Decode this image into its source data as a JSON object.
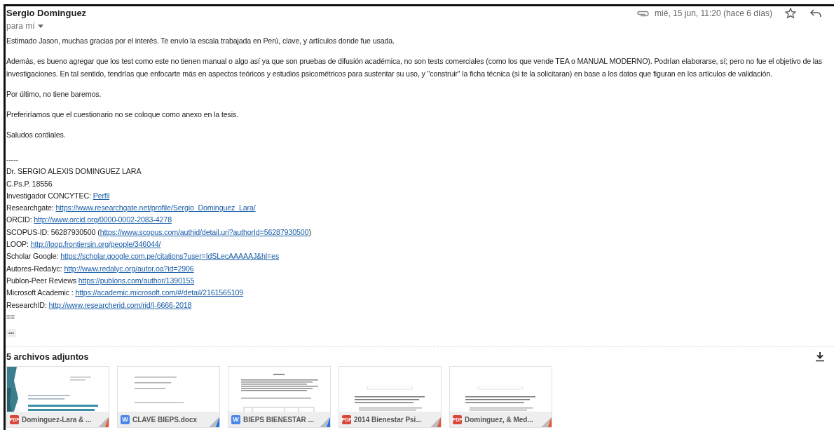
{
  "message": {
    "sender": "Sergio Dominguez",
    "recipient": "para mí",
    "date": "mié, 15 jun, 11:20 (hace 6 días)",
    "has_attachment": true,
    "starred": false,
    "paragraphs": [
      "Estimado Jason, muchas gracias por el interés. Te envío la escala trabajada en Perú, clave, y artículos donde fue usada.",
      "Además, es bueno agregar que los test como este no tienen manual o algo así ya que son pruebas de difusión académica, no son  tests comerciales (como los que vende TEA o MANUAL MODERNO). Podrían elaborarse, sí; pero no fue el objetivo de las investigaciones. En tal sentido, tendrías que enfocarte más en aspectos teóricos y estudios psicométricos para sustentar su uso, y \"construir\" la ficha técnica (si te la solicitaran) en base a los datos que figuran en los artículos de validación.",
      "Por último, no tiene baremos.",
      "Preferiríamos que el cuestionario no se coloque como anexo en la tesis.",
      "Saludos cordiales."
    ],
    "signature": [
      {
        "text": "-----"
      },
      {
        "text": "Dr. SERGIO ALEXIS DOMINGUEZ LARA"
      },
      {
        "text": "C.Ps.P. 18556"
      },
      {
        "text": "Investigador CONCYTEC: ",
        "link": "Perfil"
      },
      {
        "text": "Researchgate: ",
        "link": "https://www.researchgate.net/profile/Sergio_Dominguez_Lara/"
      },
      {
        "text": "ORCID: ",
        "link": "http://www.orcid.org/0000-0002-2083-4278"
      },
      {
        "text": "SCOPUS-ID: 56287930500 (",
        "link": "https://www.scopus.com/authid/detail.uri?authorId=56287930500",
        "after": ")"
      },
      {
        "text": "LOOP: ",
        "link": "http://loop.frontiersin.org/people/346044/"
      },
      {
        "text": "Scholar Google: ",
        "link": "https://scholar.google.com.pe/citations?user=IdSLecAAAAAJ&hl=es"
      },
      {
        "text": "Autores-Redalyc: ",
        "link": "http://www.redalyc.org/autor.oa?id=2906"
      },
      {
        "text": "Publon-Peer Reviews ",
        "link": "https://publons.com/author/1390155"
      },
      {
        "text": "Microsoft Academic : ",
        "link": "https://academic.microsoft.com/#/detail/2161565109"
      },
      {
        "text": "ResearchID: ",
        "link": "http://www.researcherid.com/rid/I-6666-2018"
      },
      {
        "text": "=="
      }
    ],
    "more": "•••"
  },
  "attachments": {
    "title": "5 archivos adjuntos",
    "files": [
      {
        "name": "Dominguez-Lara & ...",
        "kind": "pdf",
        "type_label": "PDF"
      },
      {
        "name": "CLAVE BIEPS.docx",
        "kind": "word",
        "type_label": "W"
      },
      {
        "name": "BIEPS BIENESTAR ...",
        "kind": "word",
        "type_label": "W"
      },
      {
        "name": "2014 Bienestar Psi...",
        "kind": "pdf",
        "type_label": "PDF"
      },
      {
        "name": "Dominguez, & Med...",
        "kind": "pdf",
        "type_label": "PDF"
      }
    ]
  }
}
